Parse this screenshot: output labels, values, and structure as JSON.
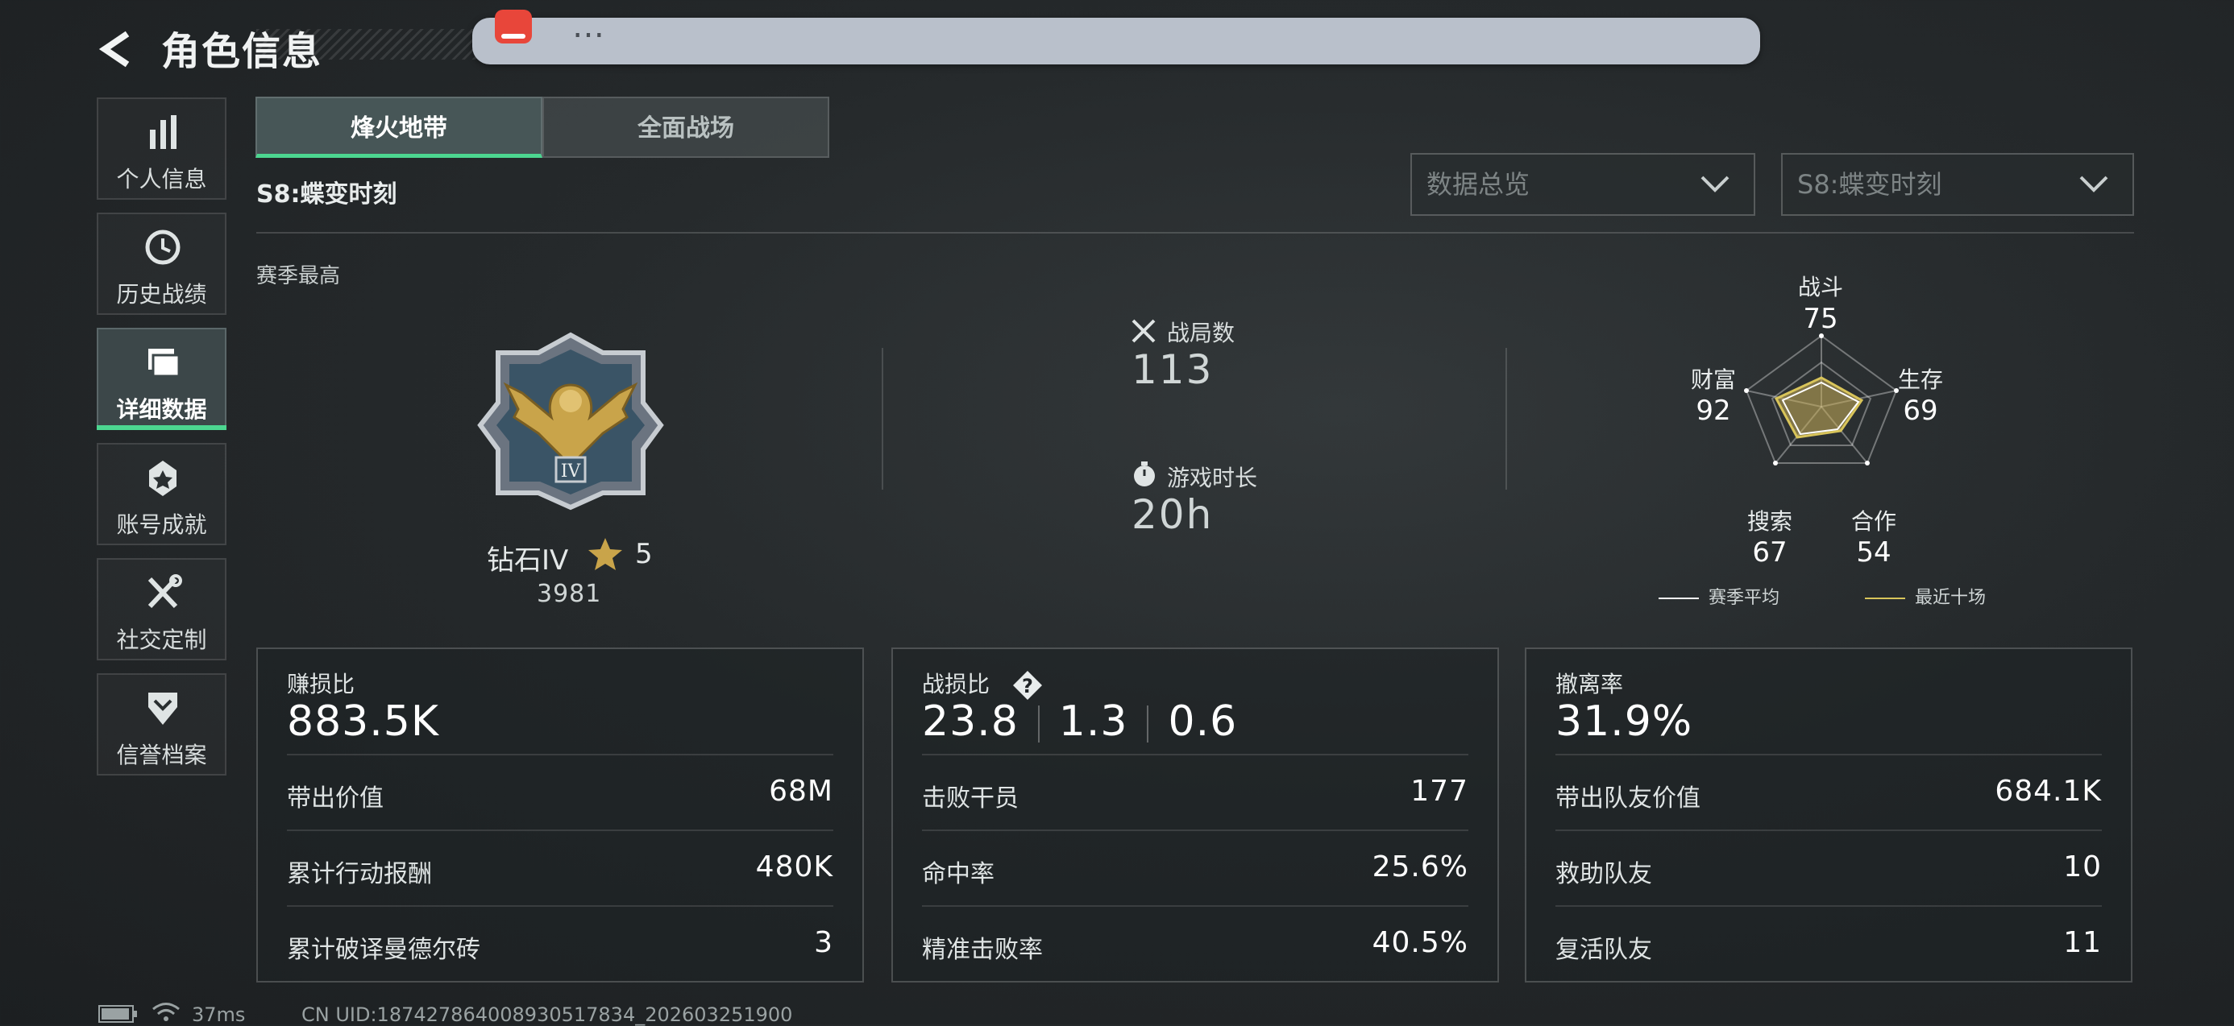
{
  "header": {
    "title": "角色信息"
  },
  "notification": {
    "text": "…"
  },
  "sidebar": {
    "items": [
      {
        "label": "个人信息",
        "icon": "bar-chart-icon"
      },
      {
        "label": "历史战绩",
        "icon": "history-icon"
      },
      {
        "label": "详细数据",
        "icon": "folder-icon",
        "active": true
      },
      {
        "label": "账号成就",
        "icon": "achievement-icon"
      },
      {
        "label": "社交定制",
        "icon": "tools-icon"
      },
      {
        "label": "信誉档案",
        "icon": "shield-badge-icon"
      }
    ]
  },
  "tabs": [
    {
      "label": "烽火地带",
      "active": true
    },
    {
      "label": "全面战场",
      "active": false
    }
  ],
  "season_title": "S8:蝶变时刻",
  "dropdowns": {
    "view": {
      "value": "数据总览"
    },
    "season": {
      "value": "S8:蝶变时刻"
    }
  },
  "overview": {
    "season_best_label": "赛季最高",
    "rank_name": "钻石IV",
    "rank_stars": "5",
    "rank_score": "3981",
    "matches_label": "战局数",
    "matches_value": "113",
    "playtime_label": "游戏时长",
    "playtime_value": "20h"
  },
  "radar": {
    "axes": [
      {
        "label": "战斗",
        "value": "75"
      },
      {
        "label": "生存",
        "value": "69"
      },
      {
        "label": "合作",
        "value": "54"
      },
      {
        "label": "搜索",
        "value": "67"
      },
      {
        "label": "财富",
        "value": "92"
      }
    ],
    "legend": {
      "season_avg": "赛季平均",
      "recent": "最近十场"
    },
    "colors": {
      "season_avg": "#ffffff",
      "recent": "#d8c45a"
    }
  },
  "cards": [
    {
      "header": "赚损比",
      "big": "883.5K",
      "rows": [
        {
          "k": "带出价值",
          "v": "68M"
        },
        {
          "k": "累计行动报酬",
          "v": "480K"
        },
        {
          "k": "累计破译曼德尔砖",
          "v": "3"
        }
      ]
    },
    {
      "header": "战损比",
      "help": "?",
      "big_parts": [
        "23.8",
        "1.3",
        "0.6"
      ],
      "rows": [
        {
          "k": "击败干员",
          "v": "177"
        },
        {
          "k": "命中率",
          "v": "25.6%"
        },
        {
          "k": "精准击败率",
          "v": "40.5%"
        }
      ]
    },
    {
      "header": "撤离率",
      "big": "31.9%",
      "rows": [
        {
          "k": "带出队友价值",
          "v": "684.1K"
        },
        {
          "k": "救助队友",
          "v": "10"
        },
        {
          "k": "复活队友",
          "v": "11"
        }
      ]
    }
  ],
  "footer": {
    "ping": "37ms",
    "uid": "CN UID:187427864008930517834_202603251900"
  },
  "colors": {
    "accent": "#4cd690",
    "gold": "#c9a44a"
  }
}
